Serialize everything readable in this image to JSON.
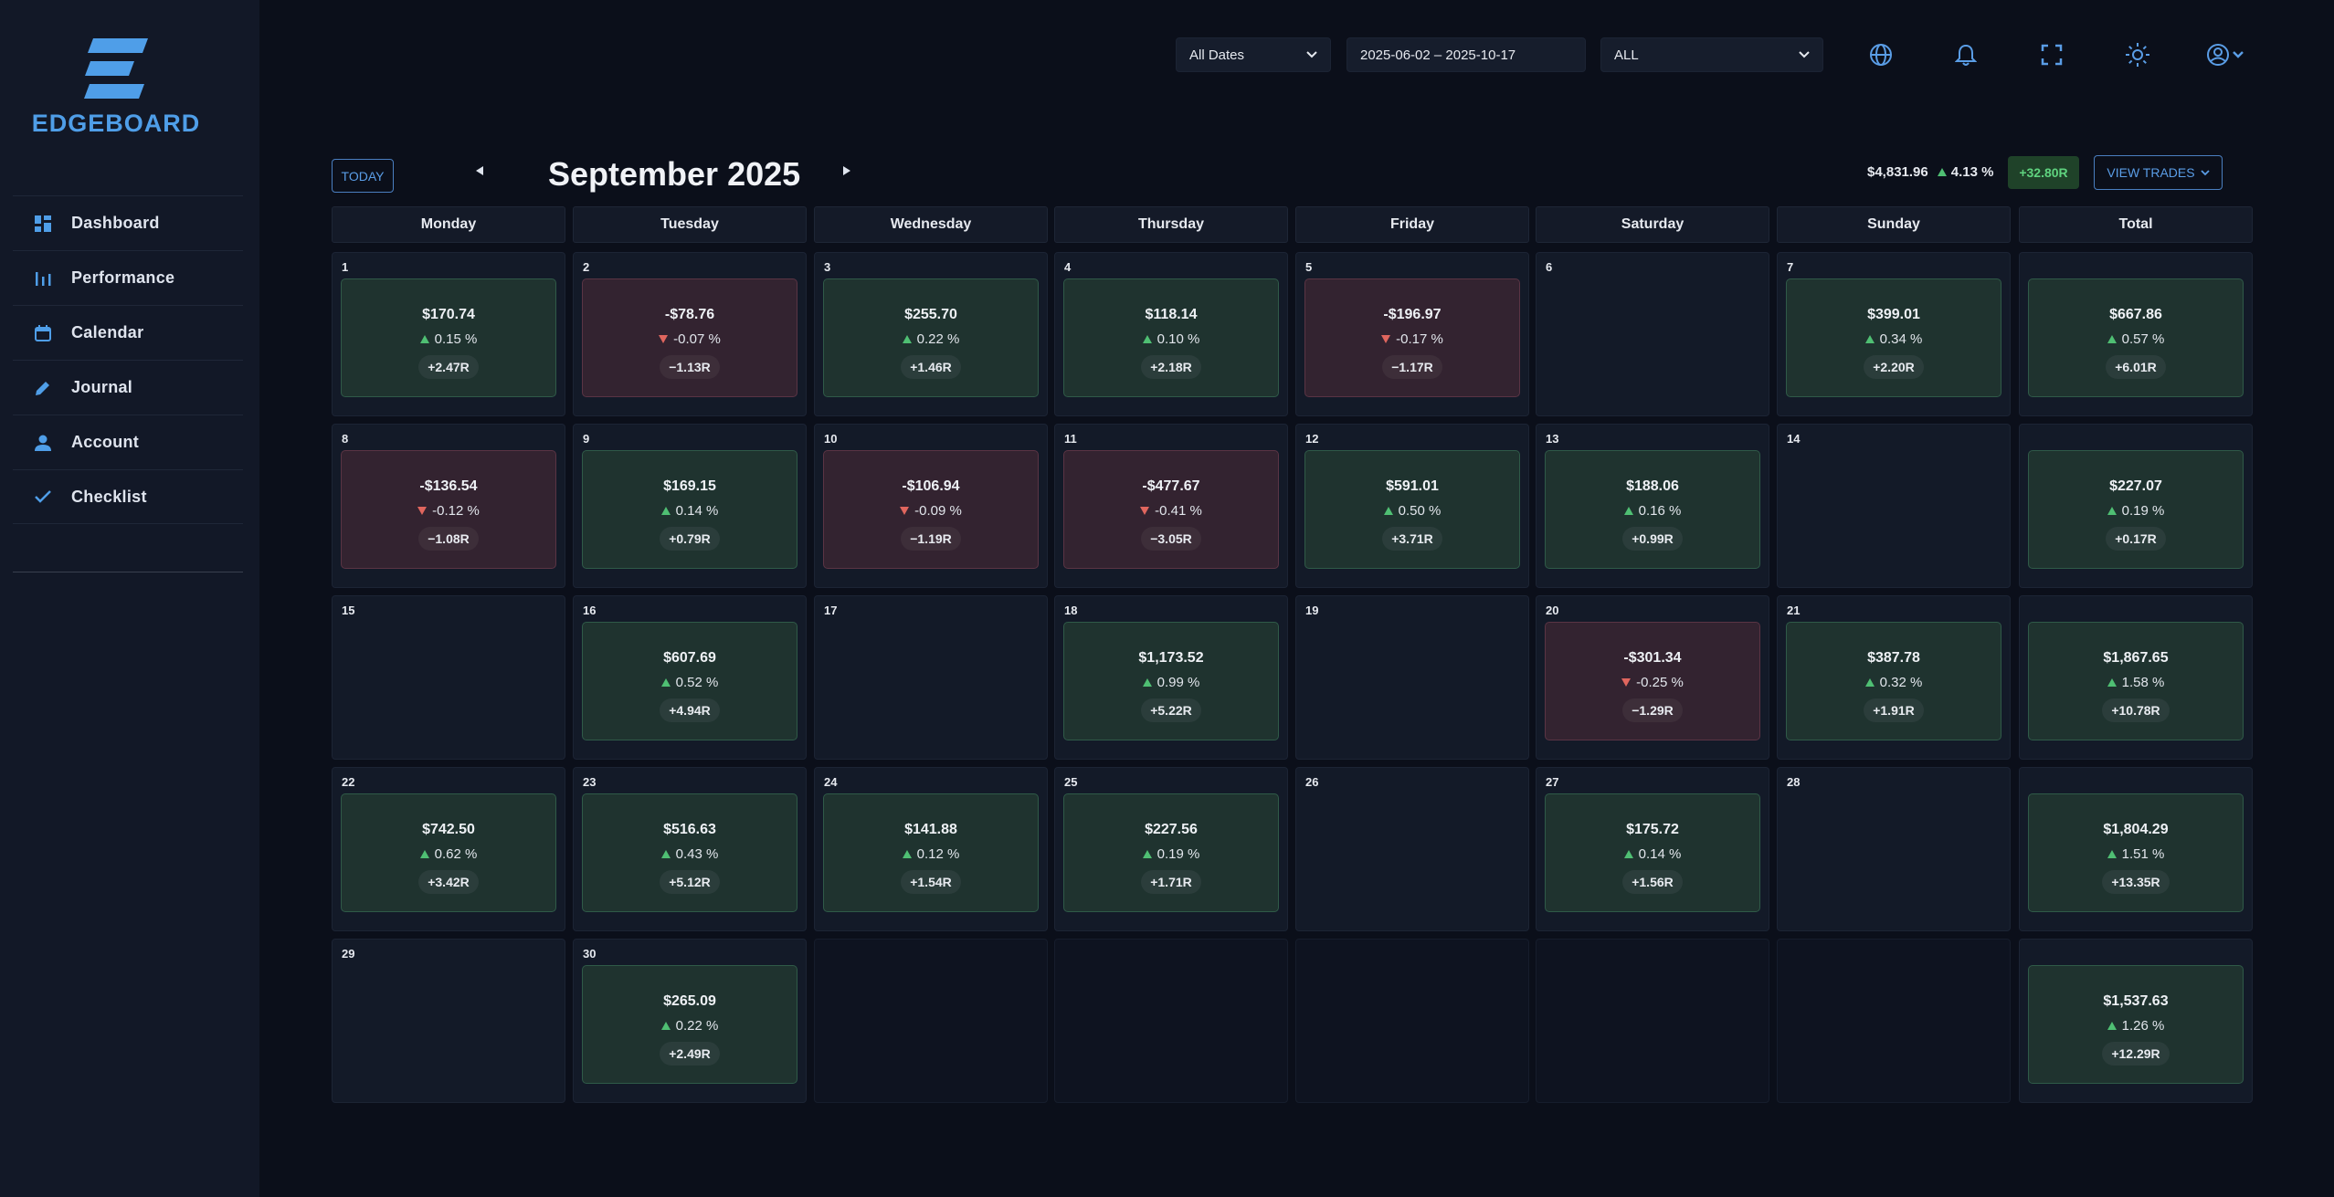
{
  "brand": {
    "name": "EDGEBOARD",
    "accent": "#4f9ee8"
  },
  "nav": [
    {
      "label": "Dashboard",
      "icon": "dashboard-icon"
    },
    {
      "label": "Performance",
      "icon": "performance-icon"
    },
    {
      "label": "Calendar",
      "icon": "calendar-icon"
    },
    {
      "label": "Journal",
      "icon": "pencil-icon"
    },
    {
      "label": "Account",
      "icon": "person-icon"
    },
    {
      "label": "Checklist",
      "icon": "check-icon"
    }
  ],
  "topbar": {
    "date_filter": "All Dates",
    "date_range": "2025-06-02 – 2025-10-17",
    "account_filter": "ALL",
    "icons": [
      "globe-icon",
      "bell-icon",
      "fullscreen-icon",
      "sun-icon",
      "user-menu-icon"
    ]
  },
  "calendar": {
    "today_label": "TODAY",
    "prev_label": "◀",
    "next_label": "▶",
    "month_title": "September 2025",
    "summary_amount": "$4,831.96",
    "summary_pct": "4.13 %",
    "summary_r": "+32.80R",
    "view_trades_label": "VIEW TRADES",
    "day_headers": [
      "Monday",
      "Tuesday",
      "Wednesday",
      "Thursday",
      "Friday",
      "Saturday",
      "Sunday",
      "Total"
    ],
    "weeks": [
      [
        {
          "day": "1",
          "amount": "$170.74",
          "pct": "0.15 %",
          "r": "+2.47R",
          "dir": "pos"
        },
        {
          "day": "2",
          "amount": "-$78.76",
          "pct": "-0.07 %",
          "r": "−1.13R",
          "dir": "neg"
        },
        {
          "day": "3",
          "amount": "$255.70",
          "pct": "0.22 %",
          "r": "+1.46R",
          "dir": "pos"
        },
        {
          "day": "4",
          "amount": "$118.14",
          "pct": "0.10 %",
          "r": "+2.18R",
          "dir": "pos"
        },
        {
          "day": "5",
          "amount": "-$196.97",
          "pct": "-0.17 %",
          "r": "−1.17R",
          "dir": "neg"
        },
        {
          "day": "6"
        },
        {
          "day": "7",
          "amount": "$399.01",
          "pct": "0.34 %",
          "r": "+2.20R",
          "dir": "pos"
        },
        {
          "day": "",
          "amount": "$667.86",
          "pct": "0.57 %",
          "r": "+6.01R",
          "dir": "pos"
        }
      ],
      [
        {
          "day": "8",
          "amount": "-$136.54",
          "pct": "-0.12 %",
          "r": "−1.08R",
          "dir": "neg"
        },
        {
          "day": "9",
          "amount": "$169.15",
          "pct": "0.14 %",
          "r": "+0.79R",
          "dir": "pos"
        },
        {
          "day": "10",
          "amount": "-$106.94",
          "pct": "-0.09 %",
          "r": "−1.19R",
          "dir": "neg"
        },
        {
          "day": "11",
          "amount": "-$477.67",
          "pct": "-0.41 %",
          "r": "−3.05R",
          "dir": "neg"
        },
        {
          "day": "12",
          "amount": "$591.01",
          "pct": "0.50 %",
          "r": "+3.71R",
          "dir": "pos"
        },
        {
          "day": "13",
          "amount": "$188.06",
          "pct": "0.16 %",
          "r": "+0.99R",
          "dir": "pos"
        },
        {
          "day": "14"
        },
        {
          "day": "",
          "amount": "$227.07",
          "pct": "0.19 %",
          "r": "+0.17R",
          "dir": "pos"
        }
      ],
      [
        {
          "day": "15"
        },
        {
          "day": "16",
          "amount": "$607.69",
          "pct": "0.52 %",
          "r": "+4.94R",
          "dir": "pos"
        },
        {
          "day": "17"
        },
        {
          "day": "18",
          "amount": "$1,173.52",
          "pct": "0.99 %",
          "r": "+5.22R",
          "dir": "pos"
        },
        {
          "day": "19"
        },
        {
          "day": "20",
          "amount": "-$301.34",
          "pct": "-0.25 %",
          "r": "−1.29R",
          "dir": "neg"
        },
        {
          "day": "21",
          "amount": "$387.78",
          "pct": "0.32 %",
          "r": "+1.91R",
          "dir": "pos"
        },
        {
          "day": "",
          "amount": "$1,867.65",
          "pct": "1.58 %",
          "r": "+10.78R",
          "dir": "pos"
        }
      ],
      [
        {
          "day": "22",
          "amount": "$742.50",
          "pct": "0.62 %",
          "r": "+3.42R",
          "dir": "pos"
        },
        {
          "day": "23",
          "amount": "$516.63",
          "pct": "0.43 %",
          "r": "+5.12R",
          "dir": "pos"
        },
        {
          "day": "24",
          "amount": "$141.88",
          "pct": "0.12 %",
          "r": "+1.54R",
          "dir": "pos"
        },
        {
          "day": "25",
          "amount": "$227.56",
          "pct": "0.19 %",
          "r": "+1.71R",
          "dir": "pos"
        },
        {
          "day": "26"
        },
        {
          "day": "27",
          "amount": "$175.72",
          "pct": "0.14 %",
          "r": "+1.56R",
          "dir": "pos"
        },
        {
          "day": "28"
        },
        {
          "day": "",
          "amount": "$1,804.29",
          "pct": "1.51 %",
          "r": "+13.35R",
          "dir": "pos"
        }
      ],
      [
        {
          "day": "29"
        },
        {
          "day": "30",
          "amount": "$265.09",
          "pct": "0.22 %",
          "r": "+2.49R",
          "dir": "pos"
        },
        {
          "blank": true
        },
        {
          "blank": true
        },
        {
          "blank": true
        },
        {
          "blank": true
        },
        {
          "blank": true
        },
        {
          "day": "",
          "amount": "$1,537.63",
          "pct": "1.26 %",
          "r": "+12.29R",
          "dir": "pos"
        }
      ]
    ]
  }
}
